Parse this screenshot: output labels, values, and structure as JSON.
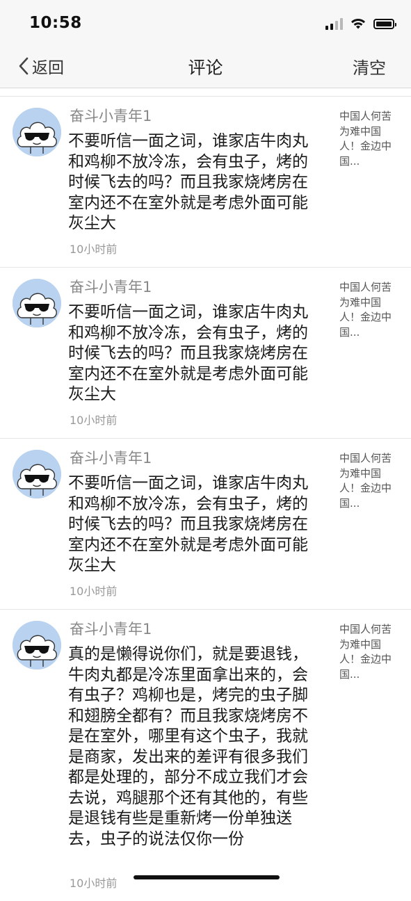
{
  "status_bar": {
    "time": "10:58"
  },
  "nav": {
    "back_label": "返回",
    "title": "评论",
    "clear_label": "清空"
  },
  "comments": [
    {
      "author": "奋斗小青年1",
      "text": "不要听信一面之词，谁家店牛肉丸和鸡柳不放冷冻，会有虫子，烤的时候飞去的吗？而且我家烧烤房在室内还不在室外就是考虑外面可能灰尘大",
      "time": "10小时前",
      "ref": "中国人何苦为难中国人！金边中国..."
    },
    {
      "author": "奋斗小青年1",
      "text": "不要听信一面之词，谁家店牛肉丸和鸡柳不放冷冻，会有虫子，烤的时候飞去的吗？而且我家烧烤房在室内还不在室外就是考虑外面可能灰尘大",
      "time": "10小时前",
      "ref": "中国人何苦为难中国人！金边中国..."
    },
    {
      "author": "奋斗小青年1",
      "text": "不要听信一面之词，谁家店牛肉丸和鸡柳不放冷冻，会有虫子，烤的时候飞去的吗？而且我家烧烤房在室内还不在室外就是考虑外面可能灰尘大",
      "time": "10小时前",
      "ref": "中国人何苦为难中国人！金边中国..."
    },
    {
      "author": "奋斗小青年1",
      "text": "真的是懒得说你们，就是要退钱，牛肉丸都是冷冻里面拿出来的，会有虫子？鸡柳也是，烤完的虫子脚和翅膀全都有？而且我家烧烤房不是在室外，哪里有这个虫子，我就是商家，发出来的差评有很多我们都是处理的，部分不成立我们才会去说，鸡腿那个还有其他的，有些是退钱有些是重新烤一份单独送去，虫子的说法仅你一份",
      "time": "10小时前",
      "ref": "中国人何苦为难中国人！金边中国..."
    }
  ]
}
